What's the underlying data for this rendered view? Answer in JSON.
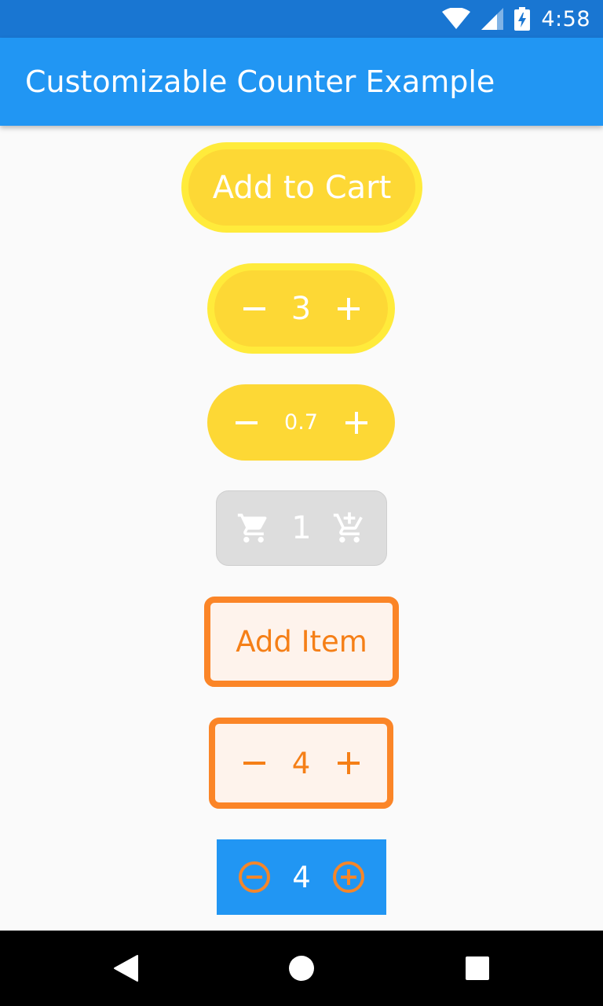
{
  "status_bar": {
    "time": "4:58",
    "icons": [
      "wifi-icon",
      "cell-signal-icon",
      "battery-charging-icon"
    ]
  },
  "app_bar": {
    "title": "Customizable Counter Example"
  },
  "counters": {
    "add_to_cart": {
      "label": "Add to Cart",
      "color": "#fdd835",
      "border_color": "#ffeb3b"
    },
    "yellow_stepper": {
      "value": "3",
      "decrement_icon": "minus-icon",
      "increment_icon": "plus-icon"
    },
    "decimal_stepper": {
      "value": "0.7",
      "decrement_icon": "minus-icon",
      "increment_icon": "plus-icon"
    },
    "cart_stepper": {
      "value": "1",
      "decrement_icon": "remove-shopping-cart-icon",
      "increment_icon": "add-shopping-cart-icon",
      "color": "#dddddd"
    },
    "add_item": {
      "label": "Add Item",
      "color": "#f57f17",
      "border_color": "#fb8527"
    },
    "orange_stepper": {
      "value": "4",
      "decrement_icon": "minus-icon",
      "increment_icon": "plus-icon"
    },
    "blue_stepper": {
      "value": "4",
      "decrement_icon": "minus-circle-icon",
      "increment_icon": "plus-circle-icon",
      "color": "#2196f3",
      "icon_color": "#f4862a"
    }
  },
  "nav_bar": {
    "icons": [
      "back-icon",
      "home-icon",
      "recents-icon"
    ]
  }
}
